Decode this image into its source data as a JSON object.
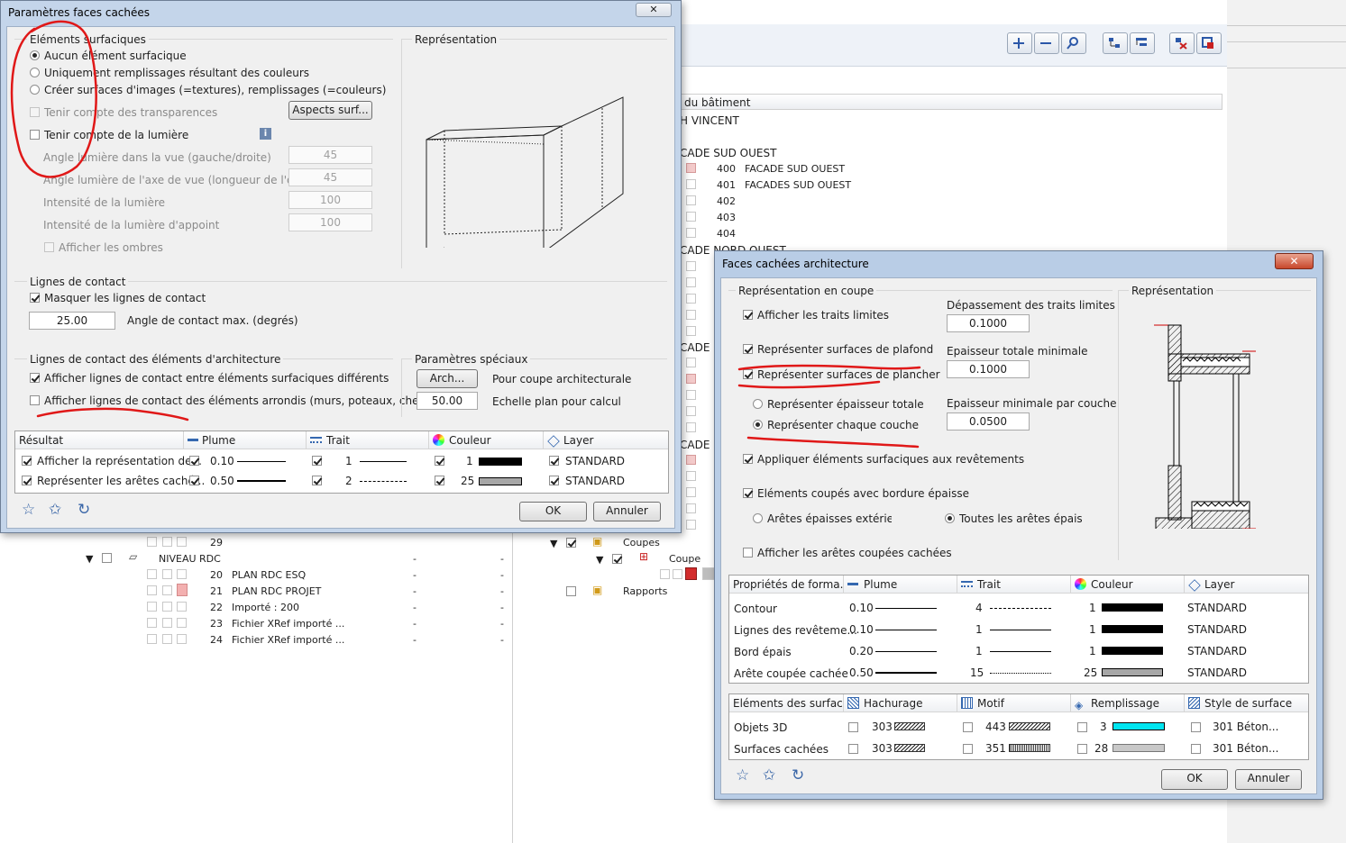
{
  "bg": {
    "table_header": "du bâtiment",
    "root": "H VINCENT",
    "group1": "CADE SUD OUEST",
    "rows": [
      {
        "num": "400",
        "name": "FACADE SUD OUEST"
      },
      {
        "num": "401",
        "name": "FACADES SUD OUEST"
      },
      {
        "num": "402",
        "name": ""
      },
      {
        "num": "403",
        "name": ""
      },
      {
        "num": "404",
        "name": ""
      }
    ],
    "group2": "CADE NORD OUEST",
    "group3": "CADE S",
    "group4": "CADE N",
    "left_rows": [
      {
        "num": "29",
        "name": "",
        "c1": "",
        "c2": ""
      },
      {
        "num": "",
        "name": "NIVEAU RDC",
        "c1": "-",
        "c2": "-"
      },
      {
        "num": "20",
        "name": "PLAN RDC ESQ",
        "c1": "-",
        "c2": "-"
      },
      {
        "num": "21",
        "name": "PLAN RDC PROJET",
        "c1": "-",
        "c2": "-"
      },
      {
        "num": "22",
        "name": "Importé : 200",
        "c1": "-",
        "c2": "-"
      },
      {
        "num": "23",
        "name": "Fichier XRef importé ...",
        "c1": "-",
        "c2": "-"
      },
      {
        "num": "24",
        "name": "Fichier XRef importé ...",
        "c1": "-",
        "c2": "-"
      }
    ],
    "coupes": "Coupes",
    "coupe": "Coupe",
    "rapports": "Rapports"
  },
  "d1": {
    "title": "Paramètres faces cachées",
    "sec_surface": "Eléments surfaciques",
    "radio1": "Aucun élément surfacique",
    "radio2": "Uniquement remplissages résultant des couleurs",
    "radio3": "Créer surfaces d'images (=textures), remplissages (=couleurs)",
    "chk_transp": "Tenir compte des transparences",
    "btn_aspects": "Aspects surf...",
    "chk_light": "Tenir compte de la lumière",
    "angle1_label": "Angle lumière dans la vue (gauche/droite)",
    "angle1_val": "45",
    "angle2_label": "Angle lumière de l'axe de vue (longueur de l'ombre",
    "angle2_val": "45",
    "int1_label": "Intensité de la lumière",
    "int1_val": "100",
    "int2_label": "Intensité de la lumière d'appoint",
    "int2_val": "100",
    "chk_shadows": "Afficher les ombres",
    "sec_repr": "Représentation",
    "sec_contact": "Lignes de contact",
    "chk_mask": "Masquer les lignes de contact",
    "angle_val": "25.00",
    "angle_label": "Angle de contact max. (degrés)",
    "sec_arch": "Lignes de contact des éléments d'architecture",
    "chk_diff": "Afficher lignes de contact entre éléments surfaciques différents",
    "chk_round": "Afficher lignes de contact des éléments arrondis (murs, poteaux, cheminées)",
    "sec_special": "Paramètres spéciaux",
    "btn_arch": "Arch...",
    "arch_label": "Pour coupe architecturale",
    "scale_val": "50.00",
    "scale_label": "Echelle plan pour calcul",
    "table_headers": [
      "Résultat",
      "Plume",
      "Trait",
      "Couleur",
      "Layer"
    ],
    "table_rows": [
      {
        "label": "Afficher la représentation de...",
        "pen": "0.10",
        "line": "1",
        "color": "1",
        "color_hex": "#000000",
        "layer": "STANDARD"
      },
      {
        "label": "Représenter les arêtes caché...",
        "pen": "0.50",
        "line": "2",
        "color": "25",
        "color_hex": "#a7a7a7",
        "layer": "STANDARD"
      }
    ],
    "ok": "OK",
    "cancel": "Annuler"
  },
  "d2": {
    "title": "Faces cachées architecture",
    "sec_coupe": "Représentation en coupe",
    "chk_traits": "Afficher les traits limites",
    "chk_plafond": "Représenter surfaces de plafond",
    "chk_plancher": "Représenter surfaces de plancher",
    "radio_total": "Représenter épaisseur totale",
    "radio_layer": "Représenter chaque couche",
    "chk_apply": "Appliquer éléments surfaciques aux revêtements",
    "chk_thick": "Eléments coupés avec bordure épaisse",
    "radio_ext": "Arêtes épaisses extérieure",
    "radio_all": "Toutes les arêtes épaisses",
    "chk_hidden": "Afficher les arêtes coupées cachées",
    "dep_label": "Dépassement des traits limites",
    "dep_val": "0.1000",
    "ep_total_label": "Epaisseur totale minimale",
    "ep_total_val": "0.1000",
    "ep_layer_label": "Epaisseur minimale par couche",
    "ep_layer_val": "0.0500",
    "sec_repr": "Représentation",
    "t1_headers": [
      "Propriétés de forma...",
      "Plume",
      "Trait",
      "Couleur",
      "Layer"
    ],
    "t1_rows": [
      {
        "label": "Contour",
        "pen": "0.10",
        "line": "4",
        "color": "1",
        "color_hex": "#000000",
        "layer": "STANDARD"
      },
      {
        "label": "Lignes des revêteme...",
        "pen": "0.10",
        "line": "1",
        "color": "1",
        "color_hex": "#000000",
        "layer": "STANDARD"
      },
      {
        "label": "Bord épais",
        "pen": "0.20",
        "line": "1",
        "color": "1",
        "color_hex": "#000000",
        "layer": "STANDARD"
      },
      {
        "label": "Arête coupée cachée",
        "pen": "0.50",
        "line": "15",
        "color": "25",
        "color_hex": "#a7a7a7",
        "layer": "STANDARD"
      }
    ],
    "t2_headers": [
      "Eléments des surfac...",
      "Hachurage",
      "Motif",
      "Remplissage",
      "Style de surface"
    ],
    "t2_rows": [
      {
        "label": "Objets 3D",
        "hatch": "303",
        "motif": "443",
        "fill": "3",
        "fill_hex": "#00e5f0",
        "style": "301 Béton..."
      },
      {
        "label": "Surfaces cachées",
        "hatch": "303",
        "motif": "351",
        "fill": "28",
        "fill_hex": "#c8c8c8",
        "style": "301 Béton..."
      }
    ],
    "ok": "OK",
    "cancel": "Annuler"
  }
}
